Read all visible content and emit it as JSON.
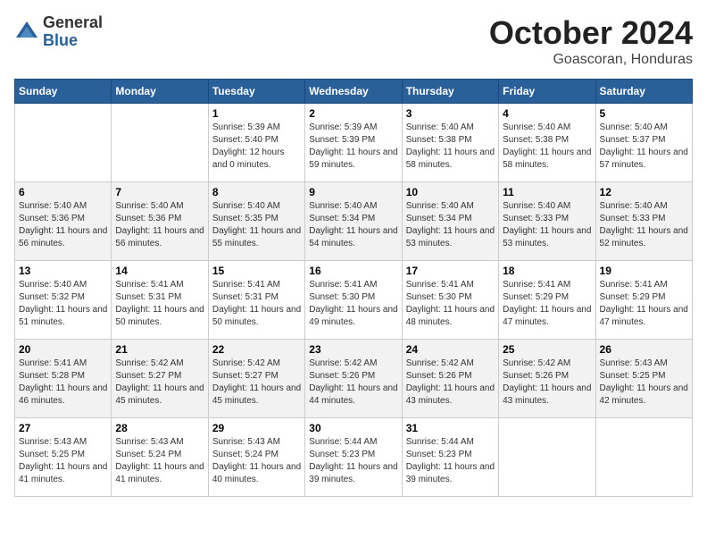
{
  "header": {
    "logo_line1": "General",
    "logo_line2": "Blue",
    "title": "October 2024",
    "subtitle": "Goascoran, Honduras"
  },
  "columns": [
    "Sunday",
    "Monday",
    "Tuesday",
    "Wednesday",
    "Thursday",
    "Friday",
    "Saturday"
  ],
  "weeks": [
    [
      {
        "day": "",
        "info": ""
      },
      {
        "day": "",
        "info": ""
      },
      {
        "day": "1",
        "info": "Sunrise: 5:39 AM\nSunset: 5:40 PM\nDaylight: 12 hours and 0 minutes."
      },
      {
        "day": "2",
        "info": "Sunrise: 5:39 AM\nSunset: 5:39 PM\nDaylight: 11 hours and 59 minutes."
      },
      {
        "day": "3",
        "info": "Sunrise: 5:40 AM\nSunset: 5:38 PM\nDaylight: 11 hours and 58 minutes."
      },
      {
        "day": "4",
        "info": "Sunrise: 5:40 AM\nSunset: 5:38 PM\nDaylight: 11 hours and 58 minutes."
      },
      {
        "day": "5",
        "info": "Sunrise: 5:40 AM\nSunset: 5:37 PM\nDaylight: 11 hours and 57 minutes."
      }
    ],
    [
      {
        "day": "6",
        "info": "Sunrise: 5:40 AM\nSunset: 5:36 PM\nDaylight: 11 hours and 56 minutes."
      },
      {
        "day": "7",
        "info": "Sunrise: 5:40 AM\nSunset: 5:36 PM\nDaylight: 11 hours and 56 minutes."
      },
      {
        "day": "8",
        "info": "Sunrise: 5:40 AM\nSunset: 5:35 PM\nDaylight: 11 hours and 55 minutes."
      },
      {
        "day": "9",
        "info": "Sunrise: 5:40 AM\nSunset: 5:34 PM\nDaylight: 11 hours and 54 minutes."
      },
      {
        "day": "10",
        "info": "Sunrise: 5:40 AM\nSunset: 5:34 PM\nDaylight: 11 hours and 53 minutes."
      },
      {
        "day": "11",
        "info": "Sunrise: 5:40 AM\nSunset: 5:33 PM\nDaylight: 11 hours and 53 minutes."
      },
      {
        "day": "12",
        "info": "Sunrise: 5:40 AM\nSunset: 5:33 PM\nDaylight: 11 hours and 52 minutes."
      }
    ],
    [
      {
        "day": "13",
        "info": "Sunrise: 5:40 AM\nSunset: 5:32 PM\nDaylight: 11 hours and 51 minutes."
      },
      {
        "day": "14",
        "info": "Sunrise: 5:41 AM\nSunset: 5:31 PM\nDaylight: 11 hours and 50 minutes."
      },
      {
        "day": "15",
        "info": "Sunrise: 5:41 AM\nSunset: 5:31 PM\nDaylight: 11 hours and 50 minutes."
      },
      {
        "day": "16",
        "info": "Sunrise: 5:41 AM\nSunset: 5:30 PM\nDaylight: 11 hours and 49 minutes."
      },
      {
        "day": "17",
        "info": "Sunrise: 5:41 AM\nSunset: 5:30 PM\nDaylight: 11 hours and 48 minutes."
      },
      {
        "day": "18",
        "info": "Sunrise: 5:41 AM\nSunset: 5:29 PM\nDaylight: 11 hours and 47 minutes."
      },
      {
        "day": "19",
        "info": "Sunrise: 5:41 AM\nSunset: 5:29 PM\nDaylight: 11 hours and 47 minutes."
      }
    ],
    [
      {
        "day": "20",
        "info": "Sunrise: 5:41 AM\nSunset: 5:28 PM\nDaylight: 11 hours and 46 minutes."
      },
      {
        "day": "21",
        "info": "Sunrise: 5:42 AM\nSunset: 5:27 PM\nDaylight: 11 hours and 45 minutes."
      },
      {
        "day": "22",
        "info": "Sunrise: 5:42 AM\nSunset: 5:27 PM\nDaylight: 11 hours and 45 minutes."
      },
      {
        "day": "23",
        "info": "Sunrise: 5:42 AM\nSunset: 5:26 PM\nDaylight: 11 hours and 44 minutes."
      },
      {
        "day": "24",
        "info": "Sunrise: 5:42 AM\nSunset: 5:26 PM\nDaylight: 11 hours and 43 minutes."
      },
      {
        "day": "25",
        "info": "Sunrise: 5:42 AM\nSunset: 5:26 PM\nDaylight: 11 hours and 43 minutes."
      },
      {
        "day": "26",
        "info": "Sunrise: 5:43 AM\nSunset: 5:25 PM\nDaylight: 11 hours and 42 minutes."
      }
    ],
    [
      {
        "day": "27",
        "info": "Sunrise: 5:43 AM\nSunset: 5:25 PM\nDaylight: 11 hours and 41 minutes."
      },
      {
        "day": "28",
        "info": "Sunrise: 5:43 AM\nSunset: 5:24 PM\nDaylight: 11 hours and 41 minutes."
      },
      {
        "day": "29",
        "info": "Sunrise: 5:43 AM\nSunset: 5:24 PM\nDaylight: 11 hours and 40 minutes."
      },
      {
        "day": "30",
        "info": "Sunrise: 5:44 AM\nSunset: 5:23 PM\nDaylight: 11 hours and 39 minutes."
      },
      {
        "day": "31",
        "info": "Sunrise: 5:44 AM\nSunset: 5:23 PM\nDaylight: 11 hours and 39 minutes."
      },
      {
        "day": "",
        "info": ""
      },
      {
        "day": "",
        "info": ""
      }
    ]
  ]
}
